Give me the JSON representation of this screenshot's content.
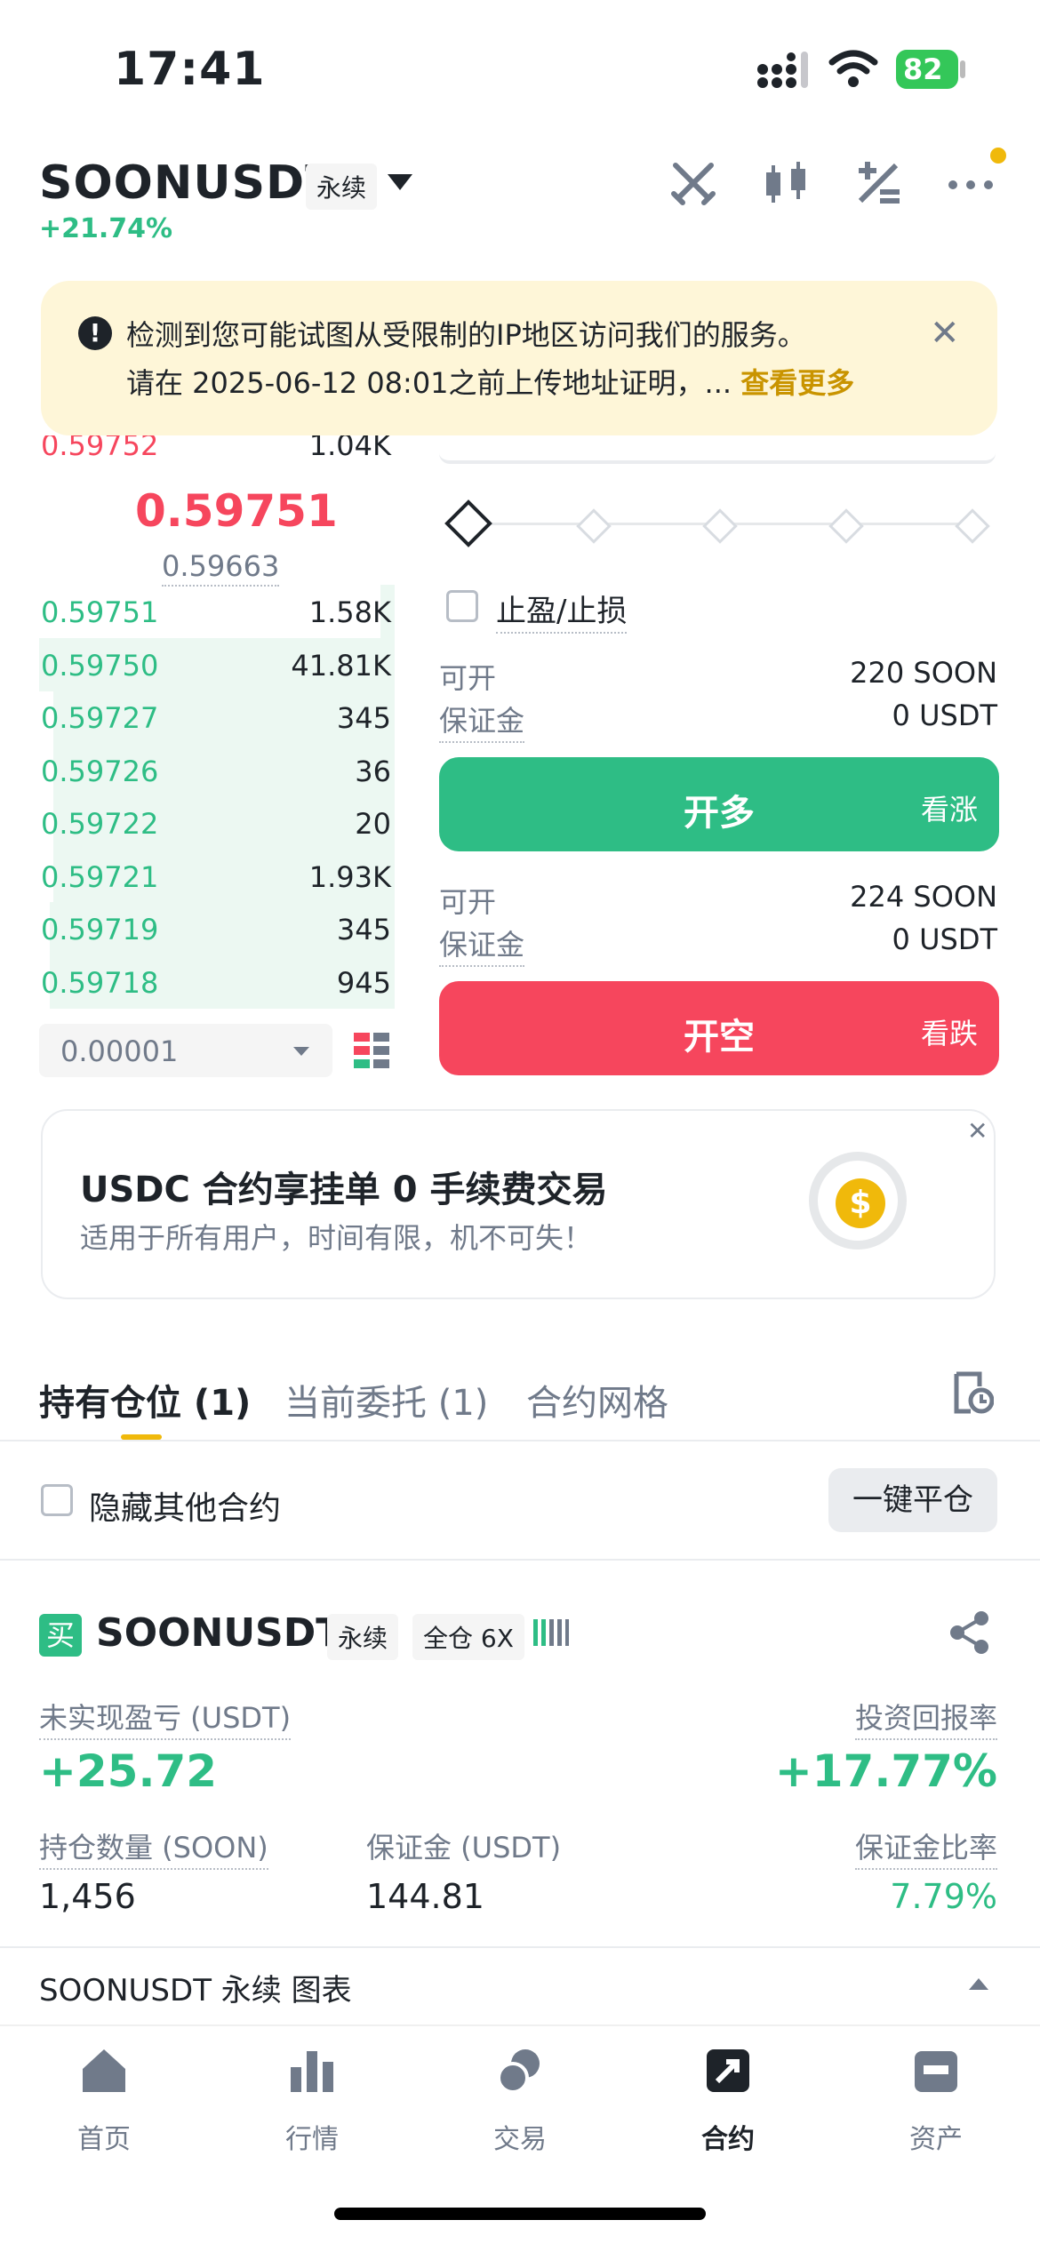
{
  "status_bar": {
    "time": "17:41",
    "battery": "82"
  },
  "header": {
    "symbol": "SOONUSDT",
    "contract_type": "永续",
    "change": "+21.74%"
  },
  "banner": {
    "line1": "检测到您可能试图从受限制的IP地区访问我们的服务。",
    "line2": "请在 2025-06-12 08:01之前上传地址证明，...",
    "more": "查看更多"
  },
  "orderbook": {
    "top_ask": {
      "price": "0.59752",
      "qty": "1.04K"
    },
    "last_price": "0.59751",
    "mark_price": "0.59663",
    "bids": [
      {
        "price": "0.59751",
        "qty": "1.58K",
        "depth": 0.04
      },
      {
        "price": "0.59750",
        "qty": "41.81K",
        "depth": 1.0
      },
      {
        "price": "0.59727",
        "qty": "345",
        "depth": 0.96
      },
      {
        "price": "0.59726",
        "qty": "36",
        "depth": 0.96
      },
      {
        "price": "0.59722",
        "qty": "20",
        "depth": 0.96
      },
      {
        "price": "0.59721",
        "qty": "1.93K",
        "depth": 0.96
      },
      {
        "price": "0.59719",
        "qty": "345",
        "depth": 0.97
      },
      {
        "price": "0.59718",
        "qty": "945",
        "depth": 0.97
      }
    ],
    "precision": "0.00001"
  },
  "trade": {
    "tp_sl_label": "止盈/止损",
    "long": {
      "available_label": "可开",
      "available_value": "220 SOON",
      "margin_label": "保证金",
      "margin_value": "0 USDT",
      "button": "开多",
      "button_sub": "看涨"
    },
    "short": {
      "available_label": "可开",
      "available_value": "224 SOON",
      "margin_label": "保证金",
      "margin_value": "0 USDT",
      "button": "开空",
      "button_sub": "看跌"
    }
  },
  "promo": {
    "title": "USDC 合约享挂单 0 手续费交易",
    "subtitle": "适用于所有用户，时间有限，机不可失！",
    "coin_symbol": "$"
  },
  "tabs": [
    "持有仓位 (1)",
    "当前委托 (1)",
    "合约网格"
  ],
  "positions_bar": {
    "hide_label": "隐藏其他合约",
    "close_all": "一键平仓"
  },
  "position": {
    "side": "买",
    "symbol": "SOONUSDT",
    "contract_type": "永续",
    "margin_mode": "全仓 6X",
    "unrealized_pnl_label": "未实现盈亏 (USDT)",
    "unrealized_pnl": "+25.72",
    "roi_label": "投资回报率",
    "roi": "+17.77%",
    "size_label": "持仓数量 (SOON)",
    "size": "1,456",
    "margin_label": "保证金 (USDT)",
    "margin": "144.81",
    "margin_ratio_label": "保证金比率",
    "margin_ratio": "7.79%"
  },
  "chart_bar": "SOONUSDT 永续  图表",
  "nav": [
    {
      "label": "首页",
      "icon": "home-icon"
    },
    {
      "label": "行情",
      "icon": "market-icon"
    },
    {
      "label": "交易",
      "icon": "trade-icon"
    },
    {
      "label": "合约",
      "icon": "futures-icon",
      "active": true
    },
    {
      "label": "资产",
      "icon": "wallet-icon"
    }
  ],
  "colors": {
    "green": "#2ebd85",
    "red": "#f6465d",
    "brand": "#f0b90b",
    "banner_bg": "#fef6d8"
  }
}
